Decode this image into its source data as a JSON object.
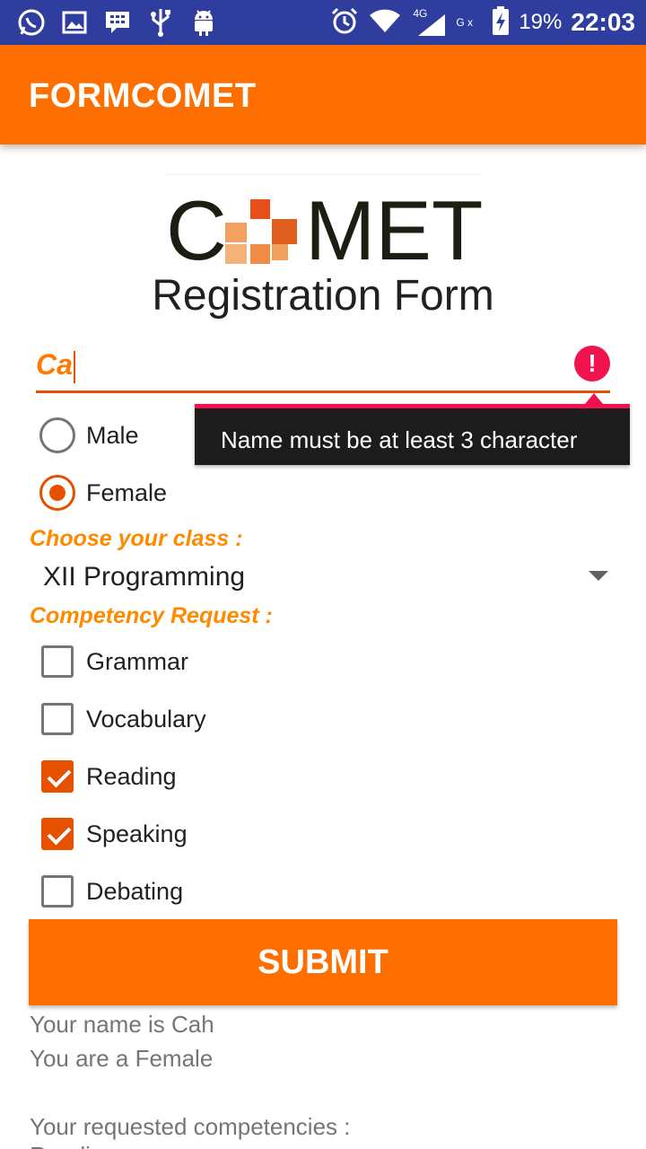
{
  "status_bar": {
    "icons": [
      "whatsapp-icon",
      "image-icon",
      "blackberry-icon",
      "usb-icon",
      "android-icon",
      "alarm-icon",
      "wifi-icon",
      "signal-4g-icon",
      "no-signal-icon",
      "battery-charging-icon"
    ],
    "network_label": "4G",
    "sim_label": "G x",
    "battery": "19%",
    "time": "22:03"
  },
  "app_bar": {
    "title": "FORMCOMET"
  },
  "logo": {
    "letters": [
      "C",
      "MET"
    ]
  },
  "form": {
    "title": "Registration Form",
    "name_value": "Ca",
    "error_message": "Name must be at least 3 character",
    "gender_options": [
      {
        "label": "Male",
        "checked": false
      },
      {
        "label": "Female",
        "checked": true
      }
    ],
    "class_label": "Choose your class :",
    "class_value": "XII Programming",
    "competency_label": "Competency Request :",
    "competencies": [
      {
        "label": "Grammar",
        "checked": false
      },
      {
        "label": "Vocabulary",
        "checked": false
      },
      {
        "label": "Reading",
        "checked": true
      },
      {
        "label": "Speaking",
        "checked": true
      },
      {
        "label": "Debating",
        "checked": false
      }
    ],
    "submit_label": "SUBMIT"
  },
  "result": {
    "line1": "Your name is Cah",
    "line2": "You are a Female",
    "line3": "Your requested competencies :",
    "line4": "Reading"
  },
  "colors": {
    "primary": "#ff6f00",
    "accent": "#e65100",
    "error": "#f0134d",
    "status_bar": "#2f3e9e"
  }
}
